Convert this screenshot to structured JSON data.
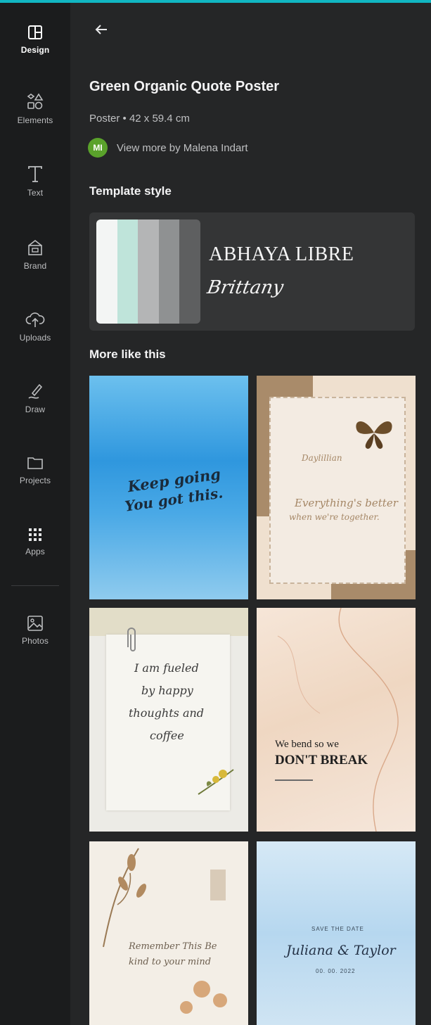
{
  "sidebar": {
    "items": [
      {
        "label": "Design",
        "icon": "layout-icon"
      },
      {
        "label": "Elements",
        "icon": "shapes-icon"
      },
      {
        "label": "Text",
        "icon": "text-icon"
      },
      {
        "label": "Brand",
        "icon": "brand-icon"
      },
      {
        "label": "Uploads",
        "icon": "upload-cloud-icon"
      },
      {
        "label": "Draw",
        "icon": "draw-pen-icon"
      },
      {
        "label": "Projects",
        "icon": "folder-icon"
      },
      {
        "label": "Apps",
        "icon": "apps-grid-icon"
      },
      {
        "label": "Photos",
        "icon": "image-icon"
      }
    ]
  },
  "panel": {
    "title": "Green Organic Quote Poster",
    "meta": "Poster • 42 x 59.4 cm",
    "author_initials": "MI",
    "author_link": "View more by Malena Indart",
    "template_style_heading": "Template style",
    "template_style": {
      "colors": [
        "#f3f5f4",
        "#bfe4da",
        "#b4b5b6",
        "#8f9192",
        "#5e5f60"
      ],
      "font_primary": "ABHAYA LIBRE",
      "font_secondary": "Brittany"
    },
    "more_heading": "More like this"
  },
  "thumbnails": [
    {
      "lines": [
        "Keep going",
        "You got this."
      ]
    },
    {
      "lines": [
        "Daylillian",
        "Everything's better",
        "when we're together."
      ]
    },
    {
      "lines": [
        "I am fueled",
        "by happy",
        "thoughts and",
        "coffee"
      ]
    },
    {
      "lines": [
        "We bend so we",
        "DON'T BREAK"
      ]
    },
    {
      "lines": [
        "Remember This Be",
        "kind to your mind"
      ]
    },
    {
      "lines": [
        "SAVE THE DATE",
        "Juliana & Taylor",
        "00. 00. 2022"
      ]
    }
  ],
  "colors": {
    "accent_topline": "#11b6c2",
    "rail_bg": "#1b1c1d",
    "panel_bg": "#252627",
    "avatar_bg": "#5aa22b"
  }
}
